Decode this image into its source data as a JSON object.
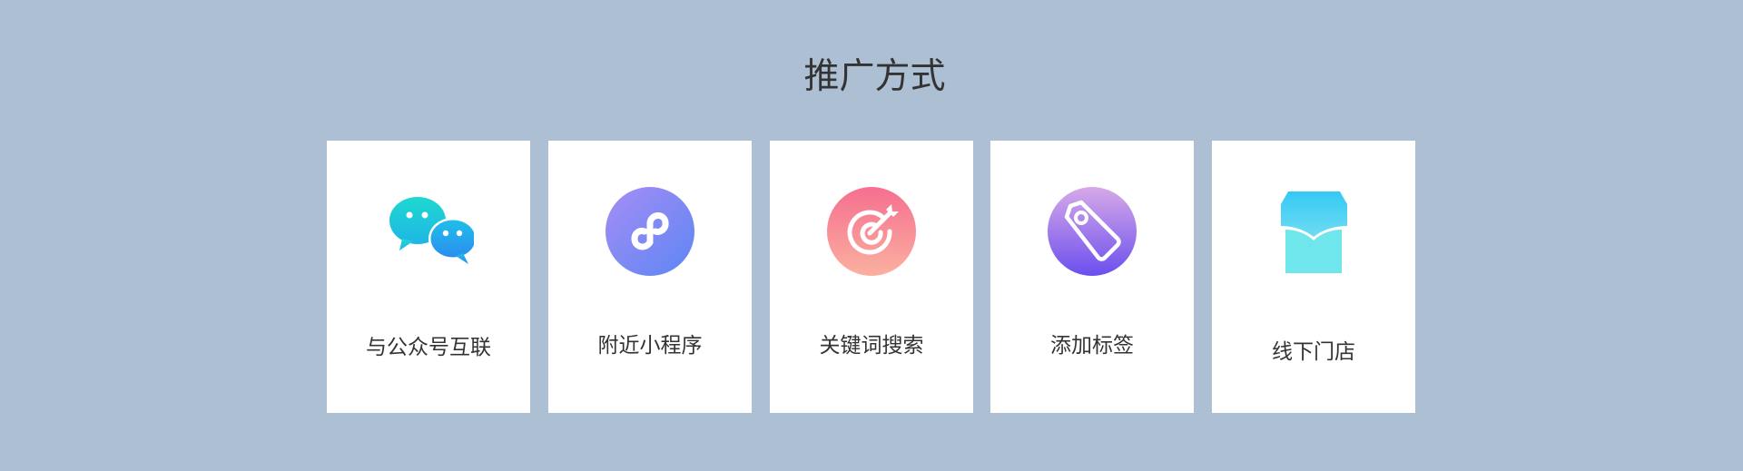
{
  "section": {
    "title": "推广方式"
  },
  "cards": [
    {
      "label": "与公众号互联",
      "icon": "wechat-icon"
    },
    {
      "label": "附近小程序",
      "icon": "mini-program-icon"
    },
    {
      "label": "关键词搜索",
      "icon": "target-icon"
    },
    {
      "label": "添加标签",
      "icon": "tag-icon"
    },
    {
      "label": "线下门店",
      "icon": "store-icon"
    }
  ],
  "colors": {
    "background": "#adbfd3",
    "card": "#ffffff",
    "text": "#333333"
  }
}
